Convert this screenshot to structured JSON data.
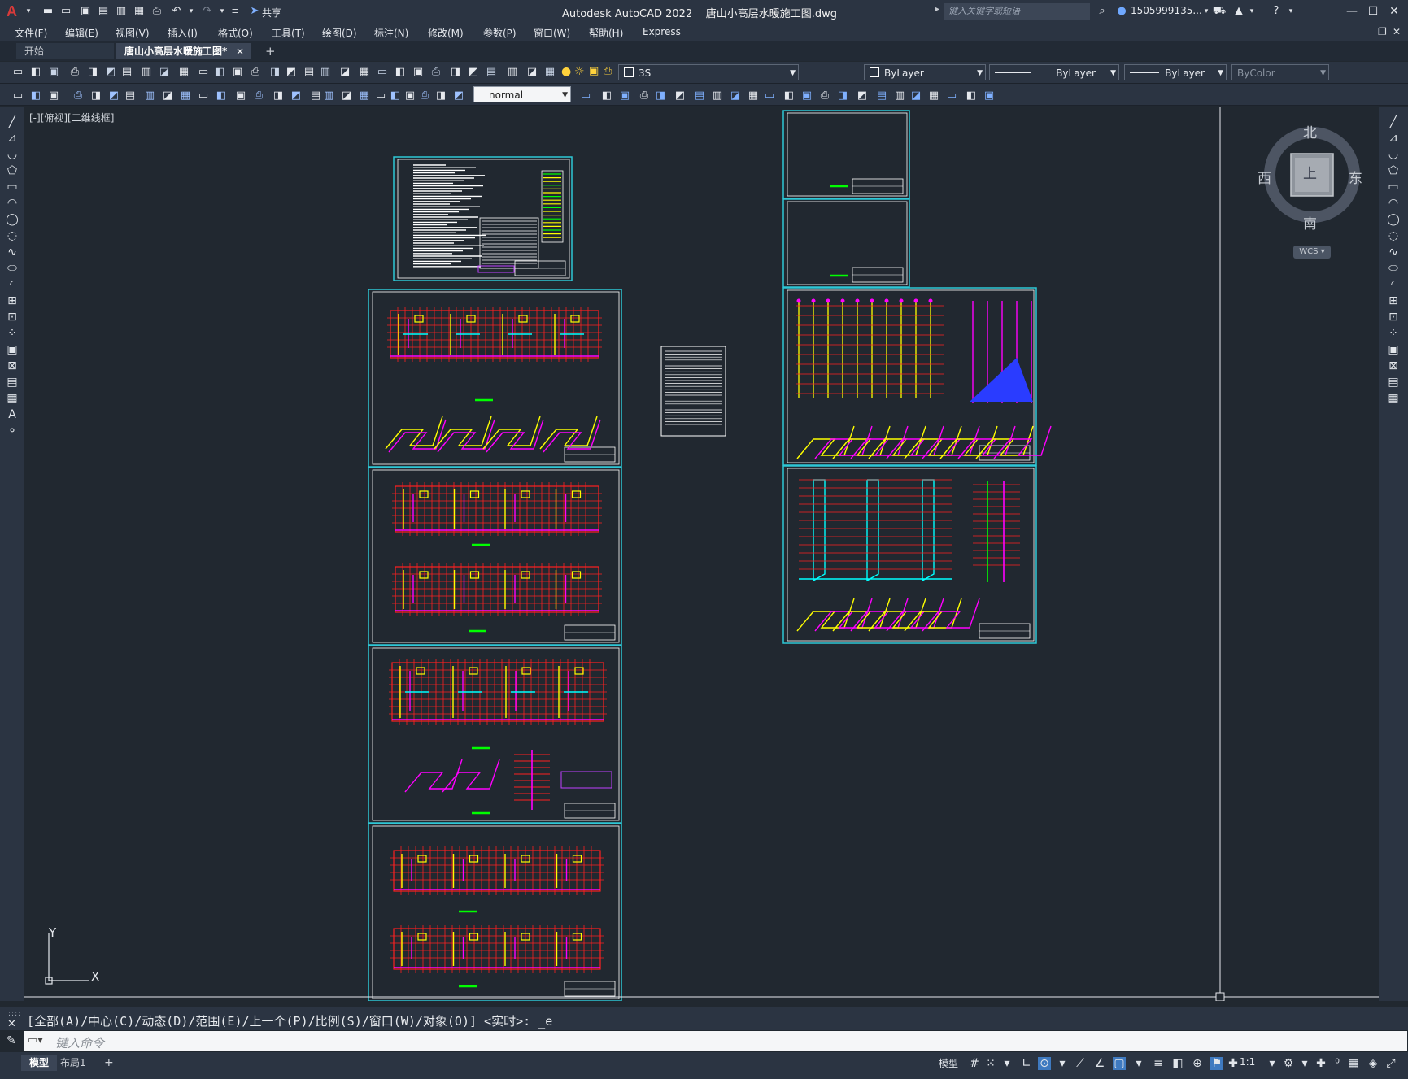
{
  "titlebar": {
    "app_title": "Autodesk AutoCAD 2022",
    "file_name": "唐山小高层水暖施工图.dwg",
    "share_label": "共享",
    "search_placeholder": "键入关键字或短语",
    "user_name": "1505999135...",
    "logo_letter": "A"
  },
  "menubar": {
    "items": [
      "文件(F)",
      "编辑(E)",
      "视图(V)",
      "插入(I)",
      "格式(O)",
      "工具(T)",
      "绘图(D)",
      "标注(N)",
      "修改(M)",
      "参数(P)",
      "窗口(W)",
      "帮助(H)",
      "Express"
    ]
  },
  "tabs": {
    "start": "开始",
    "drawing": "唐山小高层水暖施工图*",
    "close": "×",
    "add": "+"
  },
  "toolbar": {
    "layer_value": "3S",
    "color_value": "ByLayer",
    "linetype_value": "ByLayer",
    "lineweight_value": "ByLayer",
    "plotstyle_value": "ByColor",
    "textstyle_value": "normal"
  },
  "viewport": {
    "label": "[-][俯视][二维线框]"
  },
  "viewcube": {
    "north": "北",
    "south": "南",
    "east": "东",
    "west": "西",
    "face": "上",
    "wcs": "WCS"
  },
  "ucs": {
    "x": "X",
    "y": "Y"
  },
  "command": {
    "history": "[全部(A)/中心(C)/动态(D)/范围(E)/上一个(P)/比例(S)/窗口(W)/对象(O)] <实时>: _e",
    "placeholder": "键入命令"
  },
  "status": {
    "model_tab": "模型",
    "layout_tab": "布局1",
    "add_tab": "+",
    "model_label": "模型",
    "scale": "1:1"
  },
  "colors": {
    "canvas": "#212830",
    "frame": "#2ec7d6",
    "wall": "#ff2020",
    "pipe_yellow": "#ffff00",
    "pipe_magenta": "#ff00ff",
    "pipe_cyan": "#00ffff",
    "pipe_green": "#00ff00"
  }
}
